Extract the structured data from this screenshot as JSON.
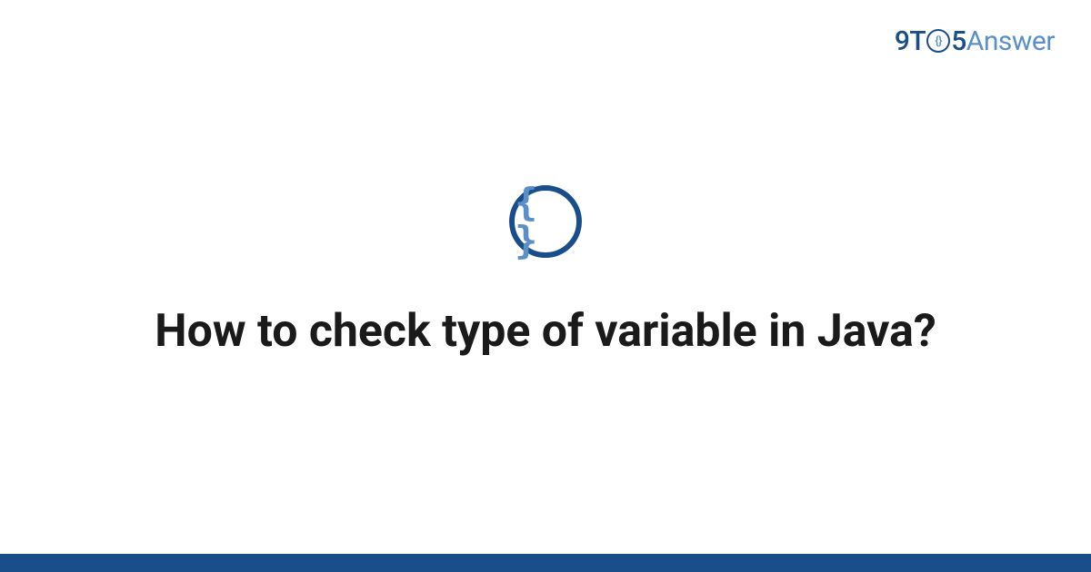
{
  "logo": {
    "part1": "9T",
    "part_o_inner": "{}",
    "part2": "5",
    "part3": "Answer"
  },
  "icon": {
    "name": "code-braces-icon",
    "glyph": "{ }"
  },
  "title": "How to check type of variable in Java?"
}
